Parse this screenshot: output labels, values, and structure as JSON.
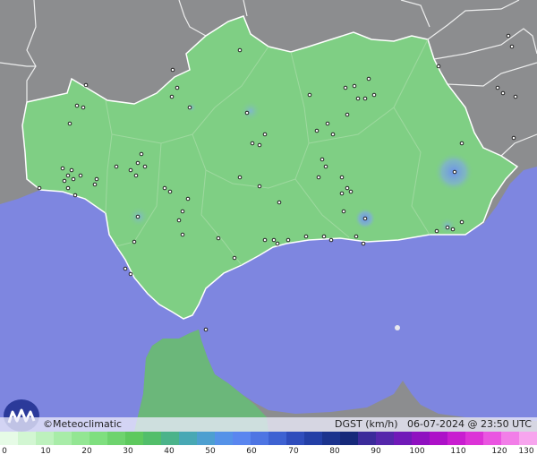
{
  "brand": {
    "copyright": "©",
    "name": "Meteoclimatic"
  },
  "meta": {
    "variable": "DGST (km/h)",
    "date": "06-07-2024",
    "at": "@",
    "time": "23:50 UTC"
  },
  "scale": {
    "ticks": [
      "0",
      "10",
      "20",
      "30",
      "40",
      "50",
      "60",
      "70",
      "80",
      "90",
      "100",
      "110",
      "120",
      "130"
    ],
    "colors": [
      "#e6fbe6",
      "#d2f6d2",
      "#bdf1bd",
      "#a8eca8",
      "#93e693",
      "#7fdf7f",
      "#6ed36e",
      "#5ec95e",
      "#52be6a",
      "#4bb38a",
      "#48a8b4",
      "#4d9fd0",
      "#5592e8",
      "#5a86ef",
      "#4e75e3",
      "#3e62d2",
      "#2f4dbc",
      "#233fa6",
      "#1b338d",
      "#16297a",
      "#3b2b9a",
      "#5527ab",
      "#7019b8",
      "#8f10c0",
      "#ad11c8",
      "#c81ed0",
      "#dc33d7",
      "#ea55e1",
      "#f27ee8",
      "#f7a5ee"
    ]
  },
  "colors": {
    "sea": "#7e86e0",
    "land_other": "#8c8d8f",
    "region": "#7fcf84",
    "gust_blue": "#6f8fe8"
  }
}
